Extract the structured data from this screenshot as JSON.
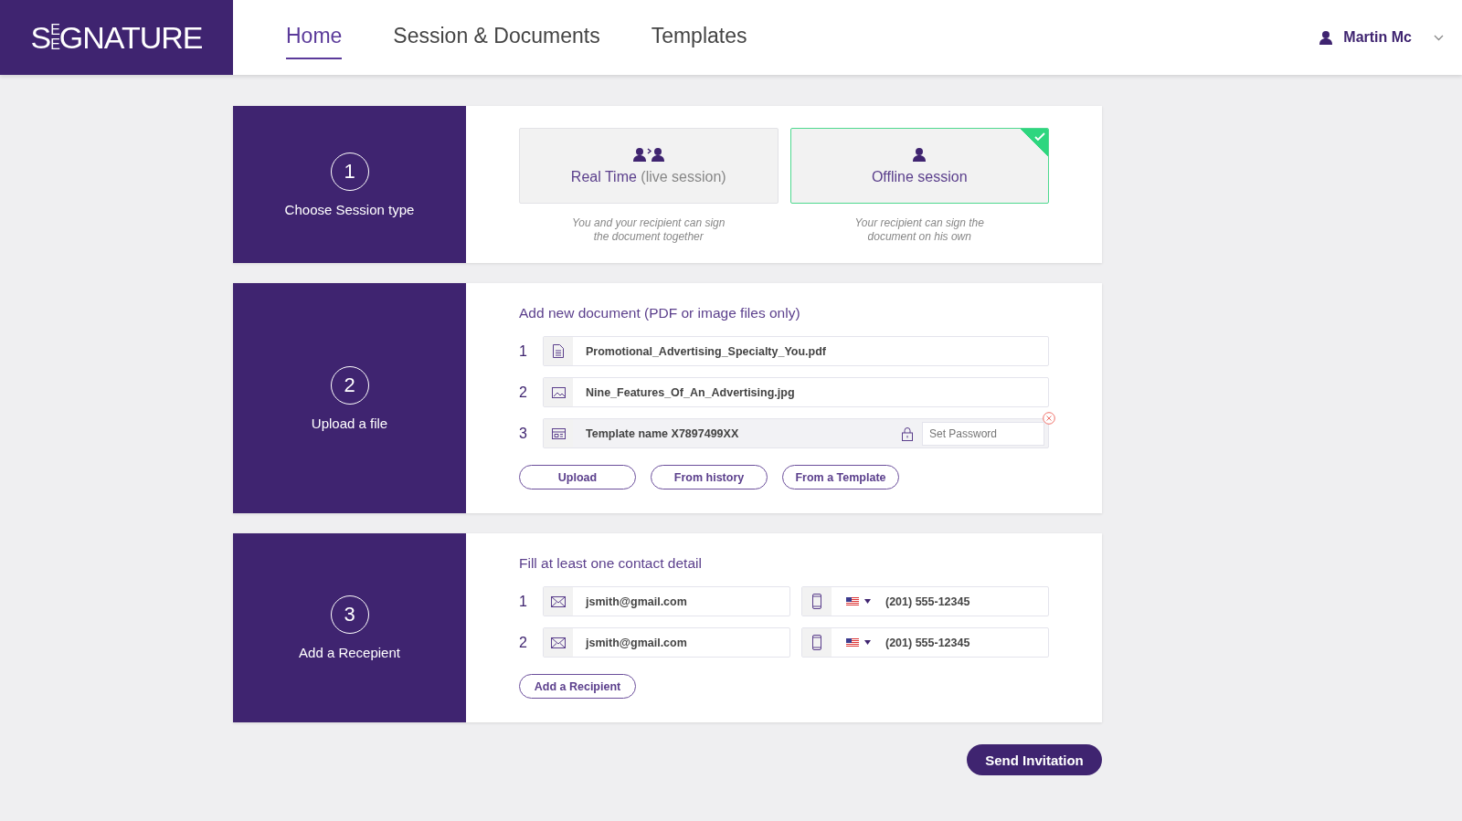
{
  "logo": {
    "lead": "S",
    "stack": [
      "E",
      "E"
    ],
    "rest": "GNATURE"
  },
  "nav": [
    {
      "label": "Home",
      "selected": true
    },
    {
      "label": "Session & Documents",
      "selected": false
    },
    {
      "label": "Templates",
      "selected": false
    }
  ],
  "user": {
    "name": "Martin Mc"
  },
  "steps": [
    {
      "kind": "session",
      "number": "1",
      "label": "Choose Session type",
      "options": [
        {
          "kind": "pair",
          "title": "Real Time",
          "note": "(live session)",
          "description": "You and your recipient can sign the document together",
          "selected": false
        },
        {
          "kind": "single",
          "title": "Offline session",
          "description": "Your recipient can sign the document on his own",
          "selected": true
        }
      ]
    },
    {
      "kind": "upload",
      "number": "2",
      "label": "Upload a file",
      "heading": "Add new document (PDF or image files only)",
      "files": [
        {
          "index": "1",
          "kind": "pdf",
          "name": "Promotional_Advertising_Specialty_You.pdf"
        },
        {
          "index": "2",
          "kind": "image",
          "name": "Nine_Features_Of_An_Advertising.jpg"
        },
        {
          "index": "3",
          "kind": "template",
          "name": "Template name X7897499XX",
          "placeholder": "Set Password"
        }
      ],
      "buttons": [
        "Upload",
        "From history",
        "From a Template"
      ]
    },
    {
      "kind": "recipient",
      "number": "3",
      "label": "Add a Recepient",
      "heading": "Fill at least one contact detail",
      "recipients": [
        {
          "index": "1",
          "email": "jsmith@gmail.com",
          "phone": "(201) 555-12345"
        },
        {
          "index": "2",
          "email": "jsmith@gmail.com",
          "phone": "(201) 555-12345"
        }
      ],
      "buttons": [
        "Add a Recipient"
      ]
    }
  ],
  "send_button": "Send Invitation"
}
